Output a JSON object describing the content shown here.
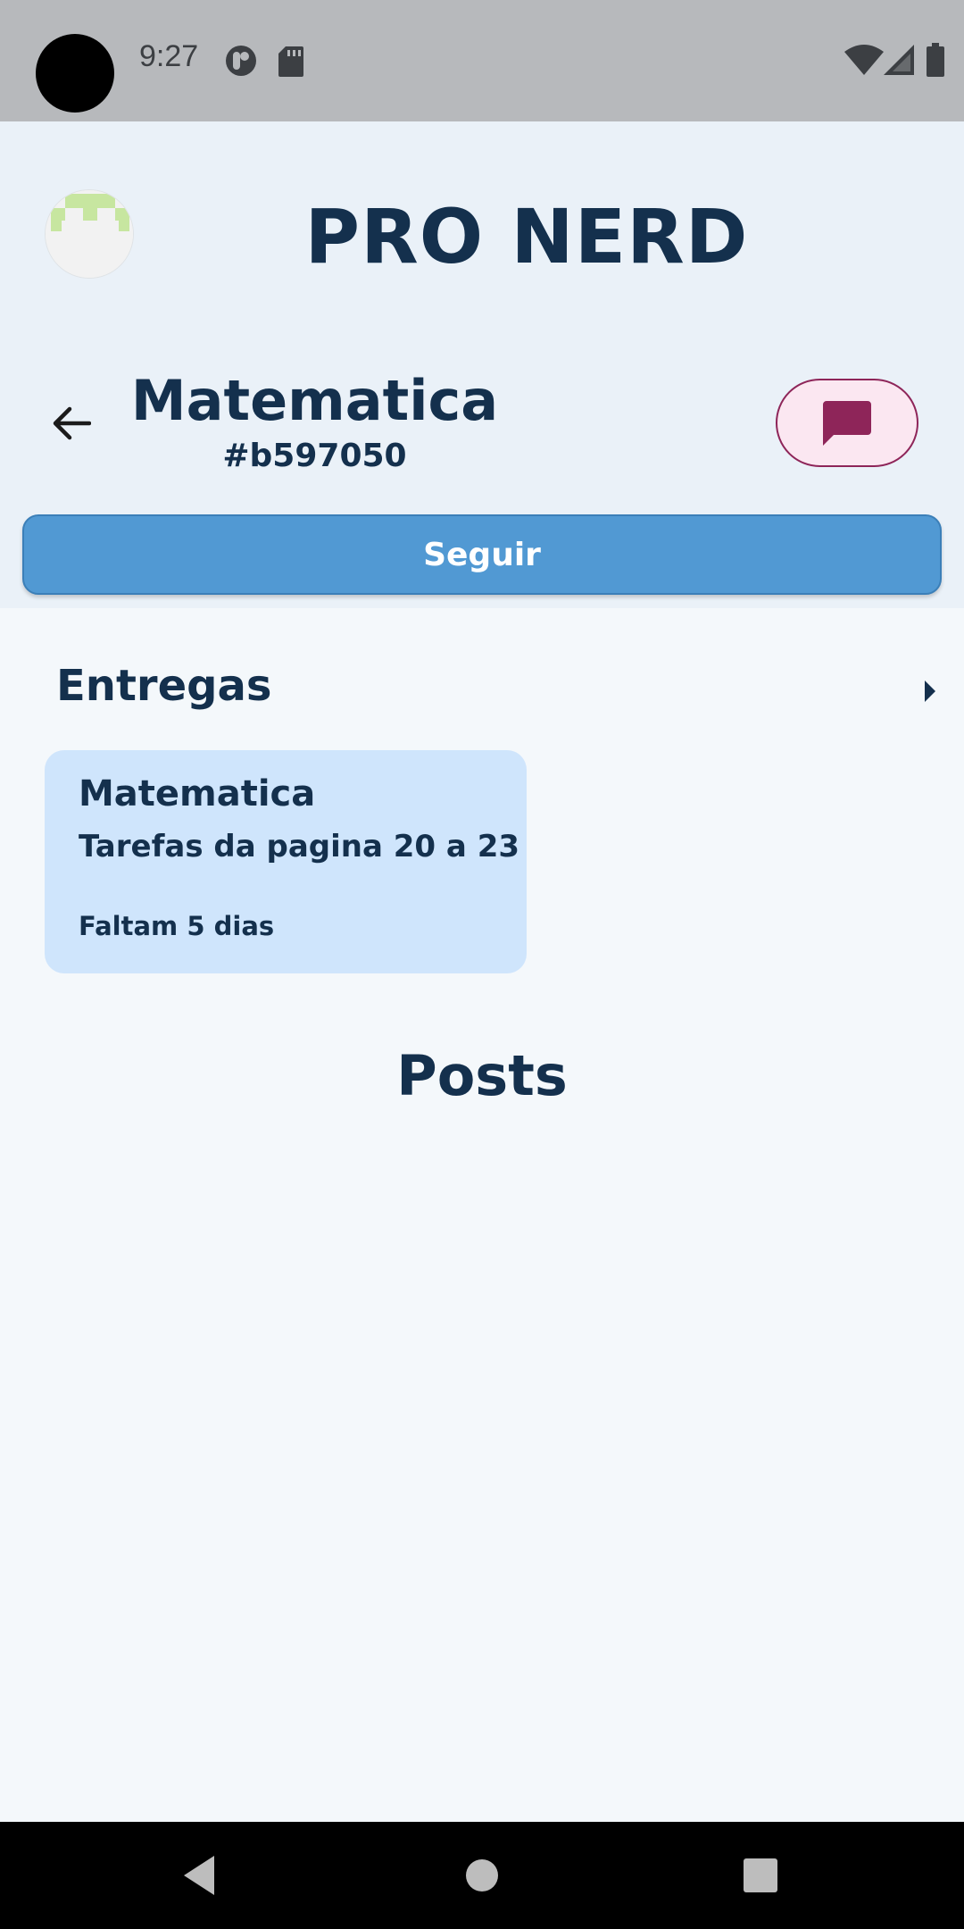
{
  "status_bar": {
    "time": "9:27",
    "left_icons": [
      "do-not-disturb-icon",
      "sd-card-icon"
    ],
    "right_icons": [
      "wifi-icon",
      "signal-icon",
      "battery-icon"
    ]
  },
  "header": {
    "app_title": "PRO NERD",
    "avatar": "avatar",
    "group_title": "Matematica",
    "group_code": "#b597050",
    "follow_label": "Seguir",
    "chat_icon": "chat-icon",
    "back_icon": "arrow-back-icon"
  },
  "deliveries": {
    "title": "Entregas",
    "items": [
      {
        "subject": "Matematica",
        "description": "Tarefas da pagina 20 a 23",
        "due": "Faltam 5 dias"
      }
    ]
  },
  "posts": {
    "title": "Posts"
  },
  "colors": {
    "primary_text": "#14304d",
    "follow_button": "#5199d3",
    "chat_button_bg": "#fbe7f1",
    "chat_accent": "#8e2559",
    "card_bg": "#cfe5fc",
    "header_bg": "#eaf1f8"
  }
}
